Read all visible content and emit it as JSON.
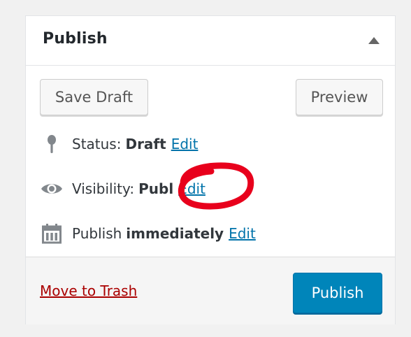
{
  "box": {
    "title": "Publish",
    "toggle_icon": "triangle-up-icon"
  },
  "actions": {
    "save_draft_label": "Save Draft",
    "preview_label": "Preview"
  },
  "status": {
    "icon": "pin-icon",
    "label": "Status:",
    "value": "Draft",
    "edit_label": "Edit"
  },
  "visibility": {
    "icon": "eye-icon",
    "label": "Visibility:",
    "value": "Publ",
    "edit_label": "Edit"
  },
  "schedule": {
    "icon": "calendar-icon",
    "label": "Publish",
    "value": "immediately",
    "edit_label": "Edit"
  },
  "footer": {
    "trash_label": "Move to Trash",
    "publish_label": "Publish"
  },
  "colors": {
    "link": "#0073aa",
    "trash_link": "#a00000",
    "primary_button": "#0085ba",
    "annotation": "#e8001c"
  }
}
